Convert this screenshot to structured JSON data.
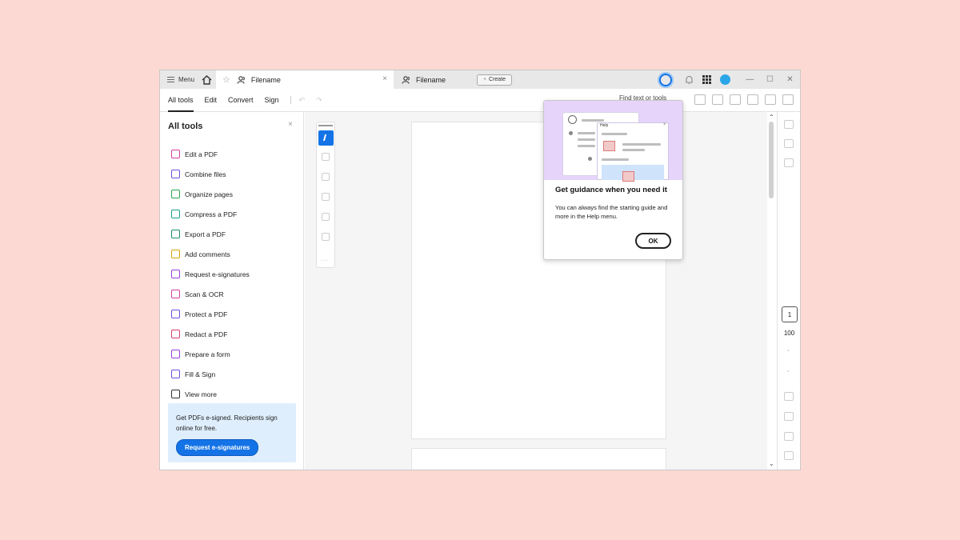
{
  "titlebar": {
    "menu_label": "Menu",
    "tabs": [
      {
        "label": "Filename",
        "active": true
      },
      {
        "label": "Filename",
        "active": false
      }
    ],
    "create_label": "Create",
    "close_tab_glyph": "×",
    "star_glyph": "☆",
    "plus_glyph": "+",
    "window_controls": [
      "—",
      "☐",
      "✕"
    ]
  },
  "toolbar": {
    "tabs": [
      "All tools",
      "Edit",
      "Convert",
      "Sign"
    ],
    "undo_glyph": "↶",
    "redo_glyph": "↷",
    "find_text": "Find text or tools"
  },
  "sidebar": {
    "title": "All tools",
    "close_glyph": "×",
    "tools": [
      {
        "label": "Edit a PDF",
        "color": "#d33fa0",
        "icon": "edit-pdf-icon"
      },
      {
        "label": "Combine files",
        "color": "#6d4fd6",
        "icon": "combine-files-icon"
      },
      {
        "label": "Organize pages",
        "color": "#2da44e",
        "icon": "organize-pages-icon"
      },
      {
        "label": "Compress a PDF",
        "color": "#1c9c8c",
        "icon": "compress-pdf-icon"
      },
      {
        "label": "Export a PDF",
        "color": "#1c8a6a",
        "icon": "export-pdf-icon"
      },
      {
        "label": "Add comments",
        "color": "#d6a300",
        "icon": "add-comments-icon"
      },
      {
        "label": "Request e-signatures",
        "color": "#9b3ed6",
        "icon": "request-esignatures-icon"
      },
      {
        "label": "Scan & OCR",
        "color": "#d33fa0",
        "icon": "scan-ocr-icon"
      },
      {
        "label": "Protect a PDF",
        "color": "#6d4fd6",
        "icon": "protect-pdf-icon"
      },
      {
        "label": "Redact a PDF",
        "color": "#d33f6a",
        "icon": "redact-pdf-icon"
      },
      {
        "label": "Prepare a form",
        "color": "#9b3ed6",
        "icon": "prepare-form-icon"
      },
      {
        "label": "Fill & Sign",
        "color": "#6d4fd6",
        "icon": "fill-sign-icon"
      },
      {
        "label": "View more",
        "color": "#333333",
        "icon": "wrench-icon"
      }
    ],
    "promo": {
      "text": "Get PDFs e-signed. Recipients sign online for free.",
      "button": "Request e-signatures"
    }
  },
  "viewer": {
    "page_number": "1",
    "zoom": "100",
    "tool_rail_more": "..."
  },
  "popup": {
    "art_help_label": "Help",
    "title": "Get guidance when you need it",
    "body": "You can always find the starting guide and more in the Help menu.",
    "ok_label": "OK"
  },
  "colors": {
    "accent": "#1473e6",
    "background": "#fdd9d3",
    "popup_art": "#e6d4fb"
  }
}
